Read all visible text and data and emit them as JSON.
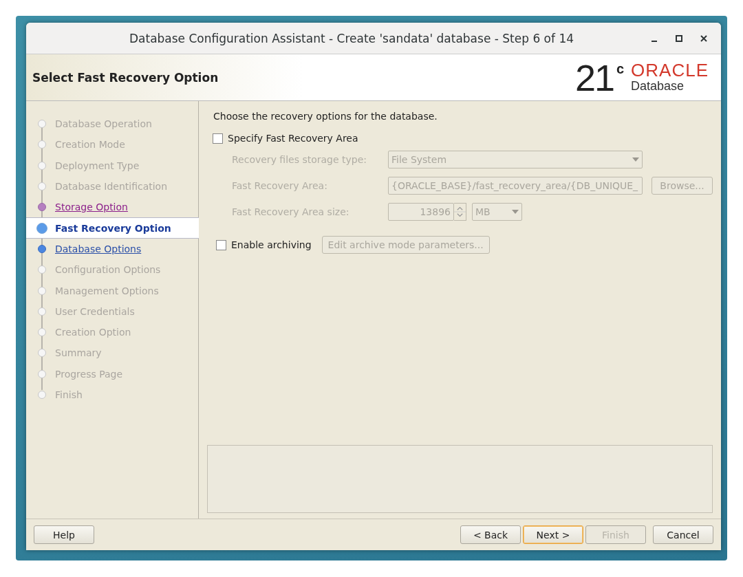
{
  "window": {
    "title": "Database Configuration Assistant - Create 'sandata' database - Step 6 of 14"
  },
  "header": {
    "title": "Select Fast Recovery Option",
    "logo": {
      "version": "21",
      "superscript": "c",
      "brand": "ORACLE",
      "product": "Database"
    }
  },
  "steps": [
    {
      "label": "Database Operation",
      "kind": "pending",
      "selected": false
    },
    {
      "label": "Creation Mode",
      "kind": "pending",
      "selected": false
    },
    {
      "label": "Deployment Type",
      "kind": "pending",
      "selected": false
    },
    {
      "label": "Database Identification",
      "kind": "pending",
      "selected": false
    },
    {
      "label": "Storage Option",
      "kind": "visited",
      "selected": false
    },
    {
      "label": "Fast Recovery Option",
      "kind": "current",
      "selected": true
    },
    {
      "label": "Database Options",
      "kind": "link",
      "selected": false
    },
    {
      "label": "Configuration Options",
      "kind": "pending",
      "selected": false
    },
    {
      "label": "Management Options",
      "kind": "pending",
      "selected": false
    },
    {
      "label": "User Credentials",
      "kind": "pending",
      "selected": false
    },
    {
      "label": "Creation Option",
      "kind": "pending",
      "selected": false
    },
    {
      "label": "Summary",
      "kind": "pending",
      "selected": false
    },
    {
      "label": "Progress Page",
      "kind": "pending",
      "selected": false
    },
    {
      "label": "Finish",
      "kind": "pending",
      "selected": false
    }
  ],
  "content": {
    "intro": "Choose the recovery options for the database.",
    "specify_fra": {
      "label": "Specify Fast Recovery Area",
      "checked": false
    },
    "fields": {
      "disabled": true,
      "storage_type": {
        "label": "Recovery files storage type:",
        "value": "File System"
      },
      "area": {
        "label": "Fast Recovery Area:",
        "value": "{ORACLE_BASE}/fast_recovery_area/{DB_UNIQUE_",
        "button": "Browse..."
      },
      "size": {
        "label": "Fast Recovery Area size:",
        "value": "13896",
        "unit": "MB"
      }
    },
    "archiving": {
      "label": "Enable archiving",
      "checked": false,
      "button": "Edit archive mode parameters...",
      "button_disabled": true
    }
  },
  "buttons": [
    {
      "label": "Help",
      "disabled": false,
      "focused": false
    },
    {
      "label": "< Back",
      "disabled": false,
      "focused": false
    },
    {
      "label": "Next >",
      "disabled": false,
      "focused": true
    },
    {
      "label": "Finish",
      "disabled": true,
      "focused": false
    },
    {
      "label": "Cancel",
      "disabled": false,
      "focused": false
    }
  ]
}
